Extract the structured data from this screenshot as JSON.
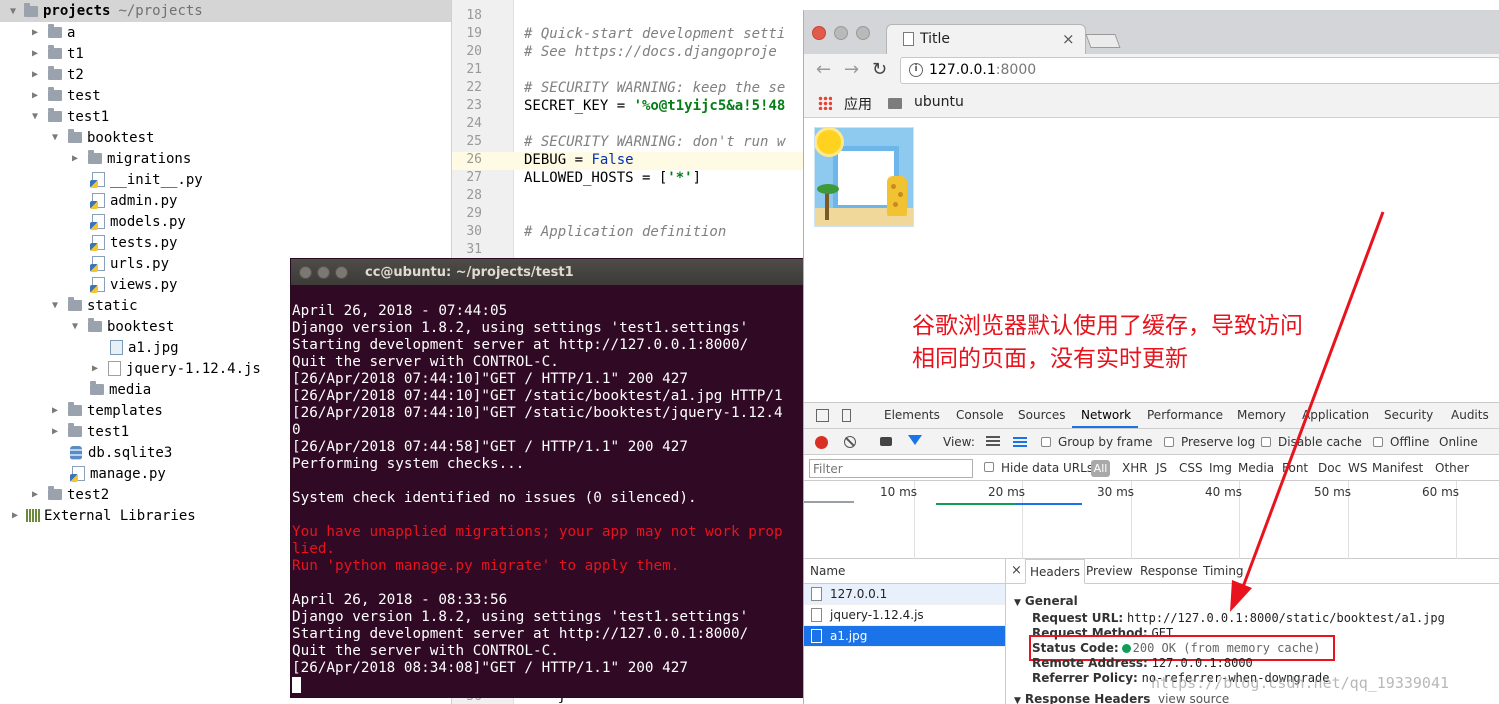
{
  "project_tree": {
    "root_label": "projects",
    "root_path": "~/projects",
    "items": [
      {
        "label": "a"
      },
      {
        "label": "t1"
      },
      {
        "label": "t2"
      },
      {
        "label": "test"
      },
      {
        "label": "test1"
      },
      {
        "label": "booktest"
      },
      {
        "label": "migrations"
      },
      {
        "label": "__init__.py"
      },
      {
        "label": "admin.py"
      },
      {
        "label": "models.py"
      },
      {
        "label": "tests.py"
      },
      {
        "label": "urls.py"
      },
      {
        "label": "views.py"
      },
      {
        "label": "static"
      },
      {
        "label": "booktest"
      },
      {
        "label": "a1.jpg"
      },
      {
        "label": "jquery-1.12.4.js"
      },
      {
        "label": "media"
      },
      {
        "label": "templates"
      },
      {
        "label": "test1"
      },
      {
        "label": "db.sqlite3"
      },
      {
        "label": "manage.py"
      },
      {
        "label": "test2"
      },
      {
        "label": "External Libraries"
      }
    ]
  },
  "editor": {
    "lines": [
      {
        "n": "18",
        "text": ""
      },
      {
        "n": "19",
        "text": "# Quick-start development setti"
      },
      {
        "n": "20",
        "text": "# See https://docs.djangoproje"
      },
      {
        "n": "21",
        "text": ""
      },
      {
        "n": "22",
        "text": "# SECURITY WARNING: keep the se"
      },
      {
        "n": "23",
        "key": "SECRET_KEY = ",
        "val": "'%o@t1yijc5&a!5!48"
      },
      {
        "n": "24",
        "text": ""
      },
      {
        "n": "25",
        "text": "# SECURITY WARNING: don't run w"
      },
      {
        "n": "26",
        "key": "DEBUG = ",
        "val": "False"
      },
      {
        "n": "27",
        "key": "ALLOWED_HOSTS = [",
        "val": "'*'",
        "tail": "]"
      },
      {
        "n": "28",
        "text": ""
      },
      {
        "n": "29",
        "text": ""
      },
      {
        "n": "30",
        "text": "# Application definition"
      },
      {
        "n": "31",
        "text": ""
      },
      {
        "n": "56",
        "text": "    }"
      }
    ]
  },
  "terminal": {
    "title": "cc@ubuntu: ~/projects/test1",
    "lines": [
      {
        "text": "April 26, 2018 - 07:44:05",
        "red": false
      },
      {
        "text": "Django version 1.8.2, using settings 'test1.settings'",
        "red": false
      },
      {
        "text": "Starting development server at http://127.0.0.1:8000/",
        "red": false
      },
      {
        "text": "Quit the server with CONTROL-C.",
        "red": false
      },
      {
        "text": "[26/Apr/2018 07:44:10]\"GET / HTTP/1.1\" 200 427",
        "red": false
      },
      {
        "text": "[26/Apr/2018 07:44:10]\"GET /static/booktest/a1.jpg HTTP/1",
        "red": false
      },
      {
        "text": "[26/Apr/2018 07:44:10]\"GET /static/booktest/jquery-1.12.4",
        "red": false
      },
      {
        "text": "0",
        "red": false
      },
      {
        "text": "[26/Apr/2018 07:44:58]\"GET / HTTP/1.1\" 200 427",
        "red": false
      },
      {
        "text": "Performing system checks...",
        "red": false
      },
      {
        "text": "",
        "red": false
      },
      {
        "text": "System check identified no issues (0 silenced).",
        "red": false
      },
      {
        "text": "",
        "red": false
      },
      {
        "text": "You have unapplied migrations; your app may not work prop",
        "red": true
      },
      {
        "text": "lied.",
        "red": true
      },
      {
        "text": "Run 'python manage.py migrate' to apply them.",
        "red": true
      },
      {
        "text": "",
        "red": false
      },
      {
        "text": "April 26, 2018 - 08:33:56",
        "red": false
      },
      {
        "text": "Django version 1.8.2, using settings 'test1.settings'",
        "red": false
      },
      {
        "text": "Starting development server at http://127.0.0.1:8000/",
        "red": false
      },
      {
        "text": "Quit the server with CONTROL-C.",
        "red": false
      },
      {
        "text": "[26/Apr/2018 08:34:08]\"GET / HTTP/1.1\" 200 427",
        "red": false
      }
    ]
  },
  "browser": {
    "tab_title": "Title",
    "tab_close": "×",
    "url_host": "127.0.0.1",
    "url_port": ":8000",
    "bookmark_apps": "应用",
    "bookmark_folder": "ubuntu",
    "annotation_line1": "谷歌浏览器默认使用了缓存，导致访问",
    "annotation_line2": "相同的页面，没有实时更新"
  },
  "devtools": {
    "tabs": [
      "Elements",
      "Console",
      "Sources",
      "Network",
      "Performance",
      "Memory",
      "Application",
      "Security",
      "Audits"
    ],
    "active_tab": "Network",
    "toolbar": {
      "view_label": "View:",
      "group_by_frame": "Group by frame",
      "preserve_log": "Preserve log",
      "disable_cache": "Disable cache",
      "offline": "Offline",
      "online": "Online"
    },
    "filter_placeholder": "Filter",
    "hide_data_urls": "Hide data URLs",
    "all_label": "All",
    "filter_types": [
      "XHR",
      "JS",
      "CSS",
      "Img",
      "Media",
      "Font",
      "Doc",
      "WS",
      "Manifest",
      "Other"
    ],
    "timeline_ticks": [
      "10 ms",
      "20 ms",
      "30 ms",
      "40 ms",
      "50 ms",
      "60 ms"
    ],
    "name_header": "Name",
    "requests": [
      {
        "name": "127.0.0.1"
      },
      {
        "name": "jquery-1.12.4.js"
      },
      {
        "name": "a1.jpg"
      }
    ],
    "detail_close": "×",
    "detail_tabs": [
      "Headers",
      "Preview",
      "Response",
      "Timing"
    ],
    "general_label": "General",
    "request_url_key": "Request URL:",
    "request_url_val": "http://127.0.0.1:8000/static/booktest/a1.jpg",
    "request_method_key": "Request Method:",
    "request_method_val": "GET",
    "status_code_key": "Status Code:",
    "status_code_val": "200 OK (from memory cache)",
    "remote_address_key": "Remote Address:",
    "remote_address_val": "127.0.0.1:8000",
    "referrer_policy_key": "Referrer Policy:",
    "referrer_policy_val": "no-referrer-when-downgrade",
    "response_headers_label": "Response Headers",
    "view_source": "view source"
  },
  "watermark": "https://blog.csdn.net/qq_19339041",
  "colors": {
    "annotation_red": "#e8131d",
    "terminal_bg": "#300a24",
    "devtools_blue": "#1a73e8",
    "status_green": "#0f9d58"
  }
}
